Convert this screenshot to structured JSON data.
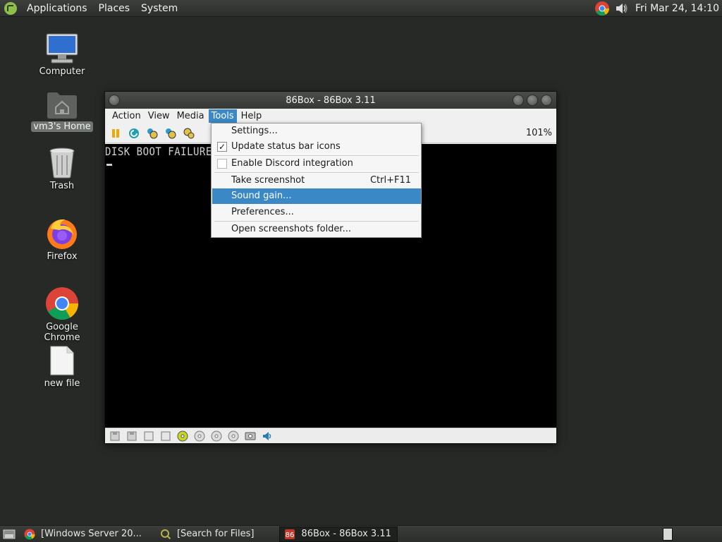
{
  "top_panel": {
    "menus": [
      "Applications",
      "Places",
      "System"
    ],
    "clock": "Fri Mar 24, 14:10"
  },
  "desktop_icons": [
    {
      "label": "Computer"
    },
    {
      "label": "vm3's Home"
    },
    {
      "label": "Trash"
    },
    {
      "label": "Firefox"
    },
    {
      "label": "Google Chrome"
    },
    {
      "label": "new file"
    }
  ],
  "window": {
    "title": "86Box - 86Box 3.11",
    "menus": [
      "Action",
      "View",
      "Media",
      "Tools",
      "Help"
    ],
    "active_menu": "Tools",
    "zoom": "101%",
    "screen_text": "DISK BOOT FAILURE,"
  },
  "tools_menu": {
    "settings": "Settings...",
    "update_status": "Update status bar icons",
    "update_status_checked": true,
    "discord": "Enable Discord integration",
    "discord_checked": false,
    "screenshot": "Take screenshot",
    "screenshot_shortcut": "Ctrl+F11",
    "sound_gain": "Sound gain...",
    "preferences": "Preferences...",
    "open_folder": "Open screenshots folder..."
  },
  "taskbar": {
    "items": [
      {
        "label": "[Windows Server 20...",
        "icon": "chrome-icon"
      },
      {
        "label": "[Search for Files]",
        "icon": "search-icon"
      },
      {
        "label": "86Box - 86Box 3.11",
        "icon": "86box-icon"
      }
    ]
  },
  "colors": {
    "desktop": "#262926",
    "highlight": "#3a88c6"
  }
}
